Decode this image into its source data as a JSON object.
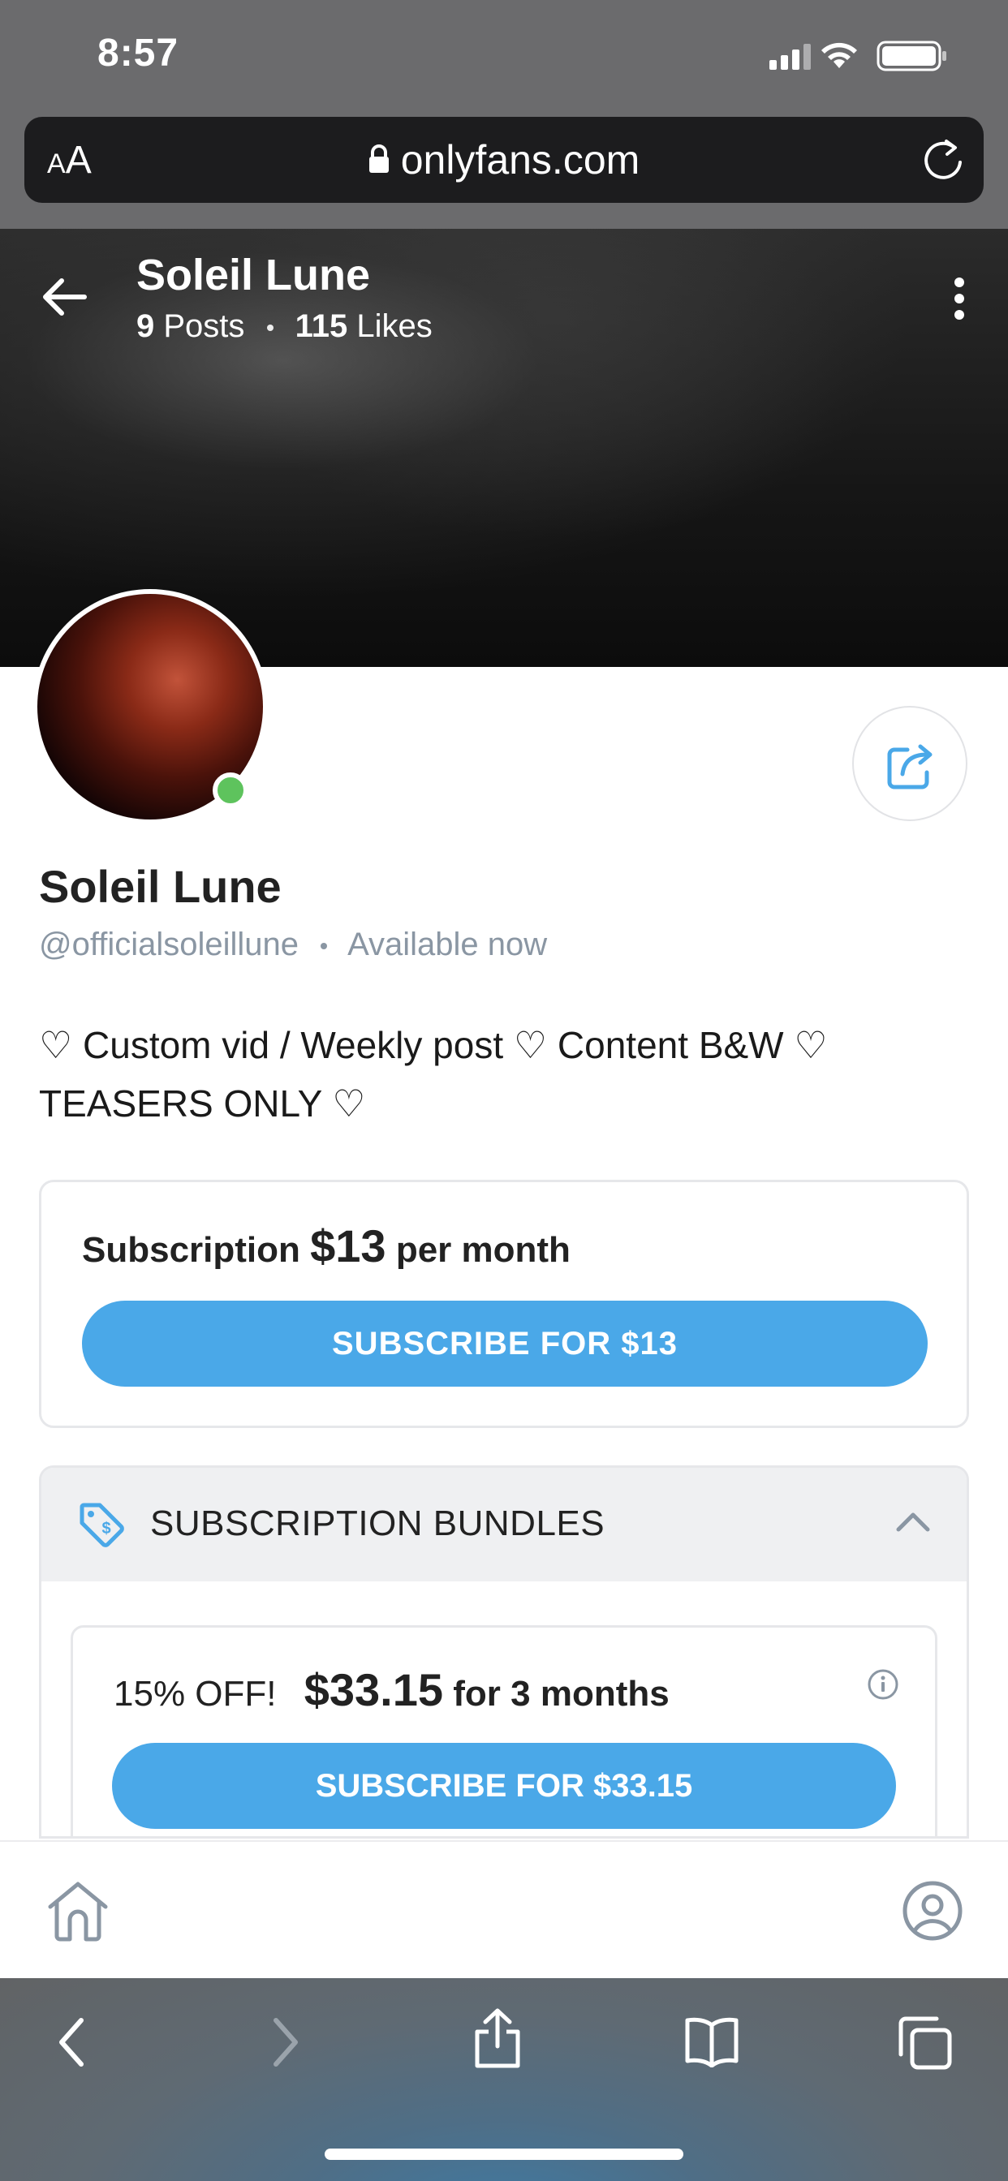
{
  "status_bar": {
    "time": "8:57"
  },
  "address_bar": {
    "aa_small": "A",
    "aa_large": "A",
    "url": "onlyfans.com"
  },
  "header": {
    "title": "Soleil Lune",
    "posts_count": "9",
    "posts_label": "Posts",
    "likes_count": "115",
    "likes_label": "Likes"
  },
  "profile": {
    "name": "Soleil Lune",
    "handle": "@officialsoleillune",
    "status": "Available now",
    "bio": "♡ Custom vid / Weekly post ♡ Content B&W ♡ TEASERS ONLY ♡"
  },
  "subscription": {
    "prefix": "Subscription",
    "price": "$13",
    "suffix": "per month",
    "button_label": "SUBSCRIBE FOR $13"
  },
  "bundles": {
    "title": "SUBSCRIPTION BUNDLES",
    "items": [
      {
        "discount": "15% OFF!",
        "price": "$33.15",
        "duration": "for 3 months",
        "button_label": "SUBSCRIBE FOR $33.15"
      }
    ]
  },
  "colors": {
    "accent": "#4aa8e8",
    "online": "#5ec35d",
    "muted_text": "#8a96a3"
  },
  "icons": {
    "status": [
      "signal-icon",
      "wifi-icon",
      "battery-icon"
    ],
    "header": [
      "back-arrow-icon",
      "more-vertical-icon"
    ],
    "profile": [
      "share-icon",
      "tag-icon",
      "chevron-up-icon",
      "info-icon"
    ],
    "app_nav": [
      "home-icon",
      "profile-icon"
    ],
    "safari_toolbar": [
      "back-icon",
      "forward-icon",
      "share-icon",
      "bookmarks-icon",
      "tabs-icon"
    ]
  }
}
